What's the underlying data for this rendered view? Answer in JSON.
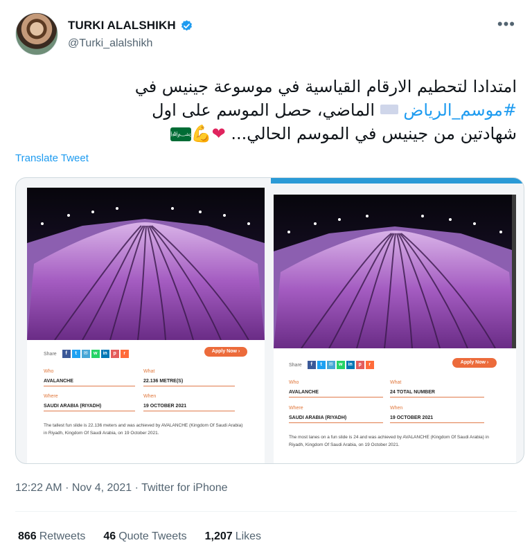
{
  "author": {
    "name": "TURKI ALALSHIKH",
    "handle": "@Turki_alalshikh",
    "verified": true,
    "accent": "#1d9bf0"
  },
  "tweet": {
    "line1": "امتدادا لتحطيم الارقام القياسية في موسوعة جينيس في",
    "hashtag": "#موسم_الرياض",
    "line2_rest": "الماضي، حصل الموسم على اول",
    "line3": "شهادتين من جينيس في الموسم الحالي...",
    "emojis": [
      "heart",
      "flexed-biceps",
      "saudi-flag"
    ],
    "translate_label": "Translate Tweet"
  },
  "media": {
    "left": {
      "share_label": "Share",
      "apply_label": "Apply Now ›",
      "who_label": "Who",
      "who": "AVALANCHE",
      "what_label": "What",
      "what": "22.136 METRE(S)",
      "where_label": "Where",
      "where": "SAUDI ARABIA (RIYADH)",
      "when_label": "When",
      "when": "19 OCTOBER 2021",
      "description": "The tallest fun slide is 22.136 meters and was achieved by AVALANCHE (Kingdom Of Saudi Arabia) in Riyadh, Kingdom Of Saudi Arabia, on 19 October 2021."
    },
    "right": {
      "share_label": "Share",
      "apply_label": "Apply Now ›",
      "who_label": "Who",
      "who": "AVALANCHE",
      "what_label": "What",
      "what": "24 TOTAL NUMBER",
      "where_label": "Where",
      "where": "SAUDI ARABIA (RIYADH)",
      "when_label": "When",
      "when": "19 OCTOBER 2021",
      "description": "The most lanes on a fun slide is 24 and was achieved by AVALANCHE (Kingdom Of Saudi Arabia) in Riyadh, Kingdom Of Saudi Arabia, on 19 October 2021."
    },
    "social_icons": [
      "facebook-icon",
      "twitter-icon",
      "email-icon",
      "whatsapp-icon",
      "linkedin-icon",
      "pinterest-icon",
      "reddit-icon"
    ]
  },
  "meta": {
    "time": "12:22 AM",
    "date": "Nov 4, 2021",
    "source": "Twitter for iPhone"
  },
  "stats": {
    "retweets_count": "866",
    "retweets_label": "Retweets",
    "quotes_count": "46",
    "quotes_label": "Quote Tweets",
    "likes_count": "1,207",
    "likes_label": "Likes"
  }
}
